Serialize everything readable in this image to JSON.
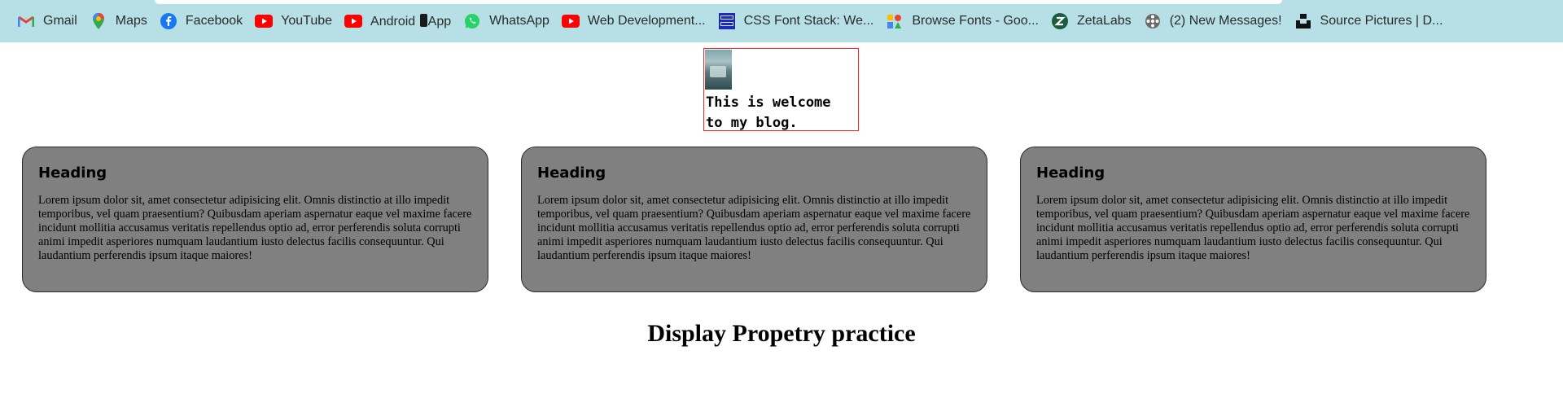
{
  "bookmarks": [
    {
      "label": "Gmail",
      "icon": "gmail-icon"
    },
    {
      "label": "Maps",
      "icon": "maps-icon"
    },
    {
      "label": "Facebook",
      "icon": "facebook-icon"
    },
    {
      "label": "YouTube",
      "icon": "youtube-icon"
    },
    {
      "label": "Android \u0000App",
      "icon": "youtube-icon"
    },
    {
      "label": "WhatsApp",
      "icon": "whatsapp-icon"
    },
    {
      "label": "Web Development...",
      "icon": "youtube-icon"
    },
    {
      "label": "CSS Font Stack: We...",
      "icon": "css-font-stack-icon"
    },
    {
      "label": "Browse Fonts - Goo...",
      "icon": "google-fonts-icon"
    },
    {
      "label": "ZetaLabs",
      "icon": "zetalabs-icon"
    },
    {
      "label": "(2) New Messages!",
      "icon": "film-reel-icon"
    },
    {
      "label": "Source Pictures | D...",
      "icon": "unsplash-icon"
    }
  ],
  "profile": {
    "text": "This is welcome to my blog."
  },
  "cards": [
    {
      "heading": "Heading",
      "body": "Lorem ipsum dolor sit, amet consectetur adipisicing elit. Omnis distinctio at illo impedit temporibus, vel quam praesentium? Quibusdam aperiam aspernatur eaque vel maxime facere incidunt mollitia accusamus veritatis repellendus optio ad, error perferendis soluta corrupti animi impedit asperiores numquam laudantium iusto delectus facilis consequuntur. Qui laudantium perferendis ipsum itaque maiores!"
    },
    {
      "heading": "Heading",
      "body": "Lorem ipsum dolor sit, amet consectetur adipisicing elit. Omnis distinctio at illo impedit temporibus, vel quam praesentium? Quibusdam aperiam aspernatur eaque vel maxime facere incidunt mollitia accusamus veritatis repellendus optio ad, error perferendis soluta corrupti animi impedit asperiores numquam laudantium iusto delectus facilis consequuntur. Qui laudantium perferendis ipsum itaque maiores!"
    },
    {
      "heading": "Heading",
      "body": "Lorem ipsum dolor sit, amet consectetur adipisicing elit. Omnis distinctio at illo impedit temporibus, vel quam praesentium? Quibusdam aperiam aspernatur eaque vel maxime facere incidunt mollitia accusamus veritatis repellendus optio ad, error perferendis soluta corrupti animi impedit asperiores numquam laudantium iusto delectus facilis consequuntur. Qui laudantium perferendis ipsum itaque maiores!"
    }
  ],
  "page_title": "Display Propetry practice",
  "colors": {
    "bookmark_bar": "#b7e0e6",
    "card_bg": "#808080",
    "profile_border": "#ff2020"
  }
}
